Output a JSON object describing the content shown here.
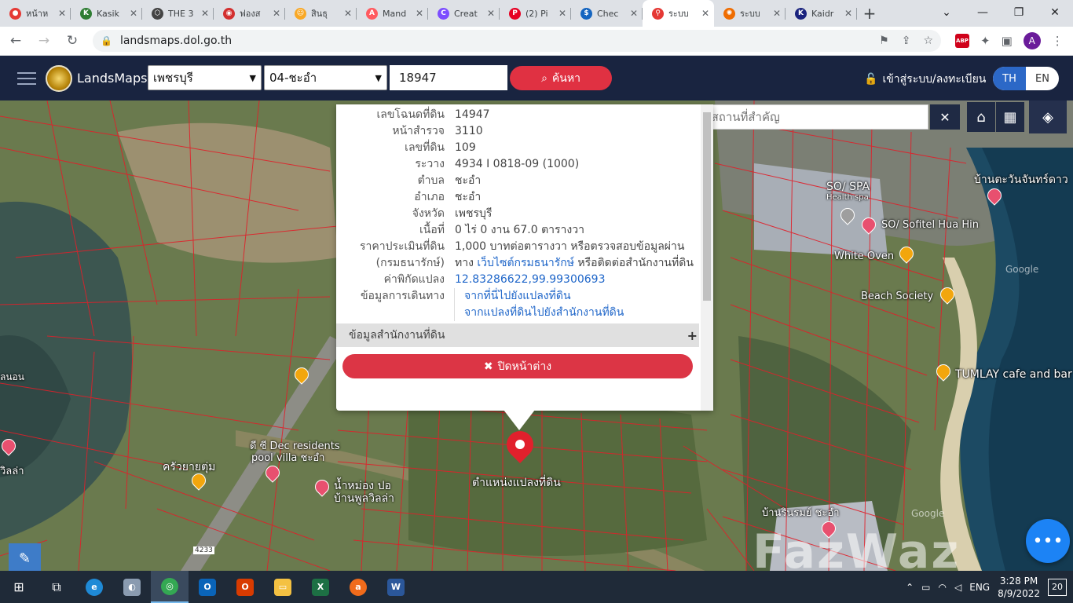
{
  "browser": {
    "tabs": [
      {
        "title": "หน้าห",
        "color": "#e53935",
        "glyph": "●"
      },
      {
        "title": "Kasik",
        "color": "#2e7d32",
        "glyph": "K"
      },
      {
        "title": "THE 3",
        "color": "#444444",
        "glyph": "⬡"
      },
      {
        "title": "ฟองส",
        "color": "#d32f2f",
        "glyph": "◉"
      },
      {
        "title": "สินธุ",
        "color": "#f9a825",
        "glyph": "☺"
      },
      {
        "title": "Mand",
        "color": "#ff5a5f",
        "glyph": "A"
      },
      {
        "title": "Creat",
        "color": "#7c4dff",
        "glyph": "C"
      },
      {
        "title": "(2) Pi",
        "color": "#e60023",
        "glyph": "P"
      },
      {
        "title": "Chec",
        "color": "#1565c0",
        "glyph": "$"
      },
      {
        "title": "ระบบ",
        "color": "#e53935",
        "glyph": "⚲",
        "active": true
      },
      {
        "title": "ระบบ",
        "color": "#ef6c00",
        "glyph": "✺"
      },
      {
        "title": "Kaidr",
        "color": "#1a237e",
        "glyph": "K"
      }
    ],
    "new_tab": "+",
    "url": "landsmaps.dol.go.th",
    "profile_initial": "A",
    "abp_label": "ABP"
  },
  "header": {
    "brand": "LandsMaps",
    "province": "เพชรบุรี",
    "district": "04-ชะอำ",
    "parcel_no": "18947",
    "search_label": "ค้นหา",
    "login_label": "เข้าสู่ระบบ/ลงทะเบียน",
    "lang_th": "TH",
    "lang_en": "EN"
  },
  "map": {
    "place_search_placeholder": "ค้นหาสถานที่สำคัญ",
    "labels": {
      "so_spa": "SO/ SPA",
      "health_spa": "Health spa",
      "sofitel": "SO/ Sofitel Hua Hin",
      "white_oven": "White Oven",
      "beach_society": "Beach Society",
      "tumlay": "TUMLAY cafe and bar",
      "ban_tawan": "บ้านตะวันจันทร์ดาว",
      "dec_resident": "ดี ซี Dec residents",
      "pool_villa": "pool villa ชะอำ",
      "krua_yai": "ครัวยายตุ่ม",
      "nam_mong": "น้ำหม่อง ปอ",
      "ban_pool": "บ้านพูลวิลล่า",
      "parcel_position": "ตำแหน่งแปลงที่ดิน",
      "ban_rinrom": "บ้านรินรมย์ ชะอำ",
      "villa_left": "วิลล่า",
      "road_4233": "4233",
      "google": "Google",
      "watermark": "FazWaz",
      "left_edge": "ลนอน"
    }
  },
  "popup": {
    "rows": [
      {
        "k": "เลขโฉนดที่ดิน",
        "v": "14947"
      },
      {
        "k": "หน้าสำรวจ",
        "v": "3110"
      },
      {
        "k": "เลขที่ดิน",
        "v": "109"
      },
      {
        "k": "ระวาง",
        "v": "4934 I 0818-09 (1000)"
      },
      {
        "k": "ตำบล",
        "v": "ชะอำ"
      },
      {
        "k": "อำเภอ",
        "v": "ชะอำ"
      },
      {
        "k": "จังหวัด",
        "v": "เพชรบุรี"
      },
      {
        "k": "เนื้อที่",
        "v": "0 ไร่ 0 งาน 67.0 ตารางวา"
      },
      {
        "k": "ราคาประเมินที่ดิน",
        "v": "1,000 บาทต่อตารางวา หรือตรวจสอบข้อมูลผ่าน"
      },
      {
        "k": "(กรมธนารักษ์)",
        "v_pre": "ทาง ",
        "v_link": "เว็บไซต์กรมธนารักษ์",
        "v_post": " หรือติดต่อสำนักงานที่ดิน"
      },
      {
        "k": "ค่าพิกัดแปลง",
        "v": "12.83286622,99.99300693",
        "link": true
      },
      {
        "k": "ข้อมูลการเดินทาง",
        "v": "จากที่นี่ไปยังแปลงที่ดิน",
        "link": true,
        "sep": true
      },
      {
        "k": "",
        "v": "จากแปลงที่ดินไปยังสำนักงานที่ดิน",
        "link": true,
        "sep": true
      }
    ],
    "office_info": "ข้อมูลสำนักงานที่ดิน",
    "close_label": "ปิดหน้าต่าง"
  },
  "taskbar": {
    "lang": "ENG",
    "time": "3:28 PM",
    "date": "8/9/2022",
    "notifications": "20"
  }
}
